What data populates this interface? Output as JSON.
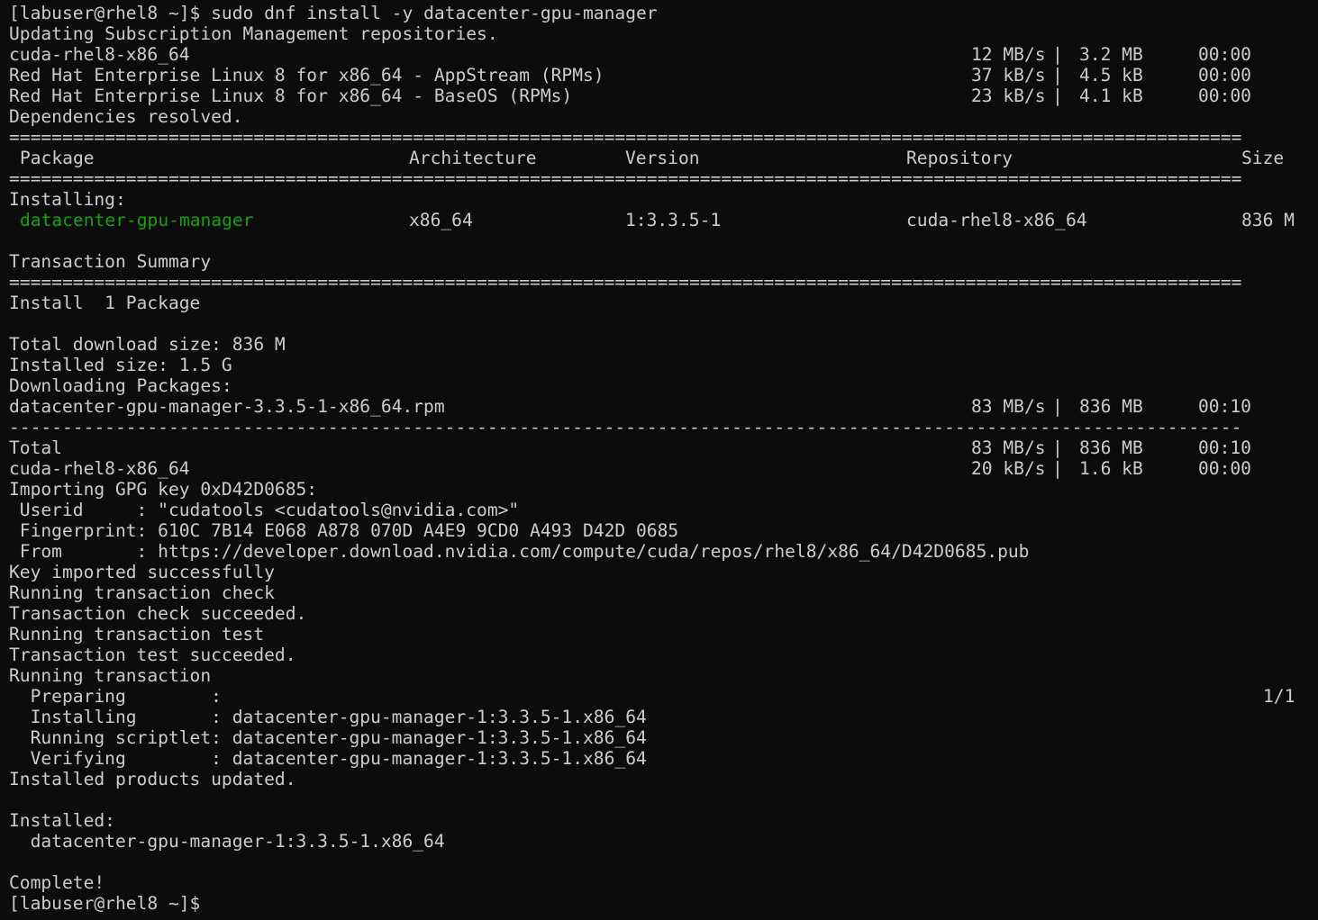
{
  "colors": {
    "background": "#0c0c0c",
    "text": "#cccccc",
    "package_name": "#13a10e"
  },
  "prompt": "[labuser@rhel8 ~]$",
  "command": "sudo dnf install -y datacenter-gpu-manager",
  "updating": "Updating Subscription Management repositories.",
  "repos": [
    {
      "name": "cuda-rhel8-x86_64",
      "speed": "12 MB/s",
      "size": "3.2 MB",
      "time": "00:00"
    },
    {
      "name": "Red Hat Enterprise Linux 8 for x86_64 - AppStream (RPMs)",
      "speed": "37 kB/s",
      "size": "4.5 kB",
      "time": "00:00"
    },
    {
      "name": "Red Hat Enterprise Linux 8 for x86_64 - BaseOS (RPMs)",
      "speed": "23 kB/s",
      "size": "4.1 kB",
      "time": "00:00"
    }
  ],
  "deps_resolved": "Dependencies resolved.",
  "separator_double": "====================================================================================================================",
  "separator_single": "--------------------------------------------------------------------------------------------------------------------",
  "table": {
    "headers": {
      "package": "Package",
      "arch": "Architecture",
      "version": "Version",
      "repo": "Repository",
      "size": "Size"
    },
    "section": "Installing:",
    "row": {
      "package": "datacenter-gpu-manager",
      "arch": "x86_64",
      "version": "1:3.3.5-1",
      "repo": "cuda-rhel8-x86_64",
      "size": "836 M"
    }
  },
  "summary": {
    "title": "Transaction Summary",
    "install": "Install  1 Package",
    "download_size": "Total download size: 836 M",
    "installed_size": "Installed size: 1.5 G",
    "downloading": "Downloading Packages:"
  },
  "download": {
    "rpm": {
      "name": "datacenter-gpu-manager-3.3.5-1-x86_64.rpm",
      "speed": "83 MB/s",
      "size": "836 MB",
      "time": "00:10"
    },
    "total": {
      "name": "Total",
      "speed": "83 MB/s",
      "size": "836 MB",
      "time": "00:10"
    },
    "cuda": {
      "name": "cuda-rhel8-x86_64",
      "speed": "20 kB/s",
      "size": "1.6 kB",
      "time": "00:00"
    }
  },
  "gpg": {
    "importing": "Importing GPG key 0xD42D0685:",
    "userid": " Userid     : \"cudatools <cudatools@nvidia.com>\"",
    "fingerprint": " Fingerprint: 610C 7B14 E068 A878 070D A4E9 9CD0 A493 D42D 0685",
    "from": " From       : https://developer.download.nvidia.com/compute/cuda/repos/rhel8/x86_64/D42D0685.pub",
    "imported": "Key imported successfully"
  },
  "transaction": {
    "check": "Running transaction check",
    "check_ok": "Transaction check succeeded.",
    "test": "Running transaction test",
    "test_ok": "Transaction test succeeded.",
    "running": "Running transaction",
    "preparing": "  Preparing        :",
    "preparing_count": "1/1",
    "installing": "  Installing       : datacenter-gpu-manager-1:3.3.5-1.x86_64",
    "scriptlet": "  Running scriptlet: datacenter-gpu-manager-1:3.3.5-1.x86_64",
    "verifying": "  Verifying        : datacenter-gpu-manager-1:3.3.5-1.x86_64",
    "products_updated": "Installed products updated."
  },
  "installed": {
    "label": "Installed:",
    "item": "  datacenter-gpu-manager-1:3.3.5-1.x86_64"
  },
  "complete": "Complete!",
  "final_prompt": "[labuser@rhel8 ~]$"
}
